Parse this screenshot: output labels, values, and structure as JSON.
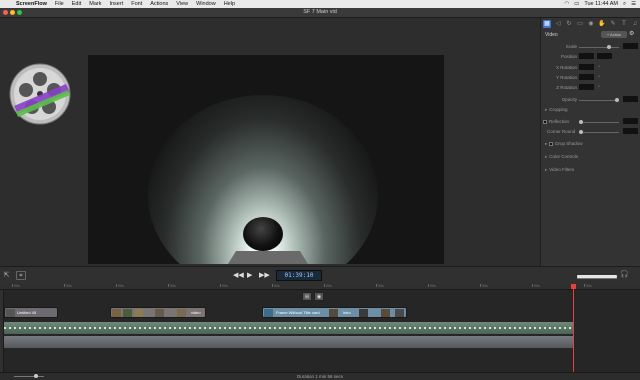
{
  "menubar": {
    "apple": "",
    "app": "ScreenFlow",
    "items": [
      "File",
      "Edit",
      "Mark",
      "Insert",
      "Font",
      "Actions",
      "View",
      "Window",
      "Help"
    ],
    "clock": "Tue 11:44 AM"
  },
  "window": {
    "title": "SF 7 Main vid"
  },
  "inspector": {
    "section": "Video",
    "button": "+ Action",
    "rows": [
      "Scale",
      "Position",
      "X Rotation",
      "Y Rotation",
      "Z Rotation",
      "Opacity"
    ],
    "sections": [
      "Cropping",
      "Reflection",
      "Corner Round",
      "Drop Shadow",
      "Color Controls",
      "Video Filters"
    ]
  },
  "transport": {
    "timecode": "01:39:10"
  },
  "ruler": [
    "00s",
    "00s",
    "00s",
    "00s",
    "00s",
    "00s",
    "00s",
    "00s",
    "00s",
    "00s",
    "00s",
    "00s"
  ],
  "clips": [
    "Untitled 45",
    "Frame Without Title card",
    "intro",
    "video"
  ],
  "status": {
    "duration": "Duration 1 min 56 secs"
  },
  "colors": {
    "accent": "#3f74d8",
    "playhead": "#e54040",
    "timecode_bg": "#1a2a3a"
  }
}
